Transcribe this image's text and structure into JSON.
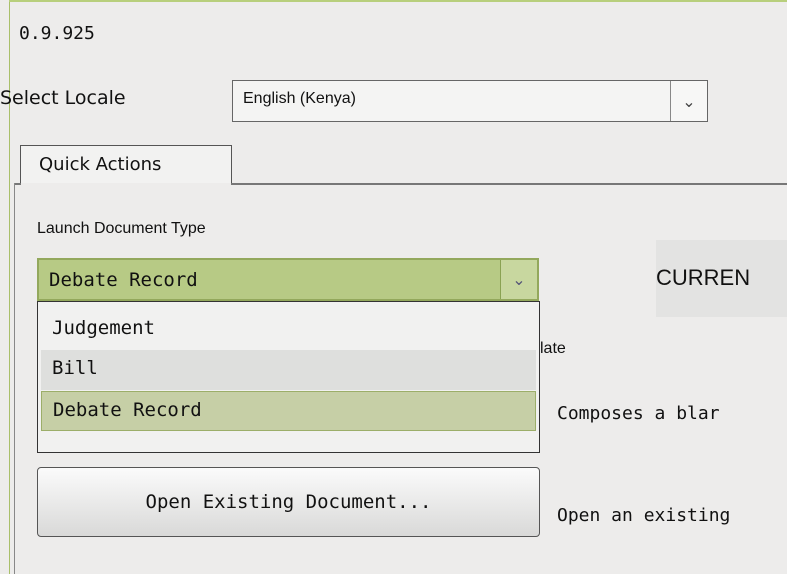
{
  "version": "0.9.925",
  "locale": {
    "label": "Select Locale",
    "selected": "English (Kenya)",
    "arrow_icon": "chevron-down-icon"
  },
  "tabs": [
    {
      "label": "Quick Actions",
      "active": true
    }
  ],
  "quick_actions": {
    "launch_label": "Launch Document Type",
    "selected_type": "Debate Record",
    "type_options": [
      "Judgement",
      "Bill",
      "Debate Record"
    ],
    "current_heading": "CURREN",
    "template_label": "late",
    "compose_desc": "Composes a blar",
    "open_button": "Open Existing Document...",
    "open_desc": "Open an existing"
  },
  "colors": {
    "accent": "#b7ca85",
    "selected_item": "#c6cfa6"
  }
}
